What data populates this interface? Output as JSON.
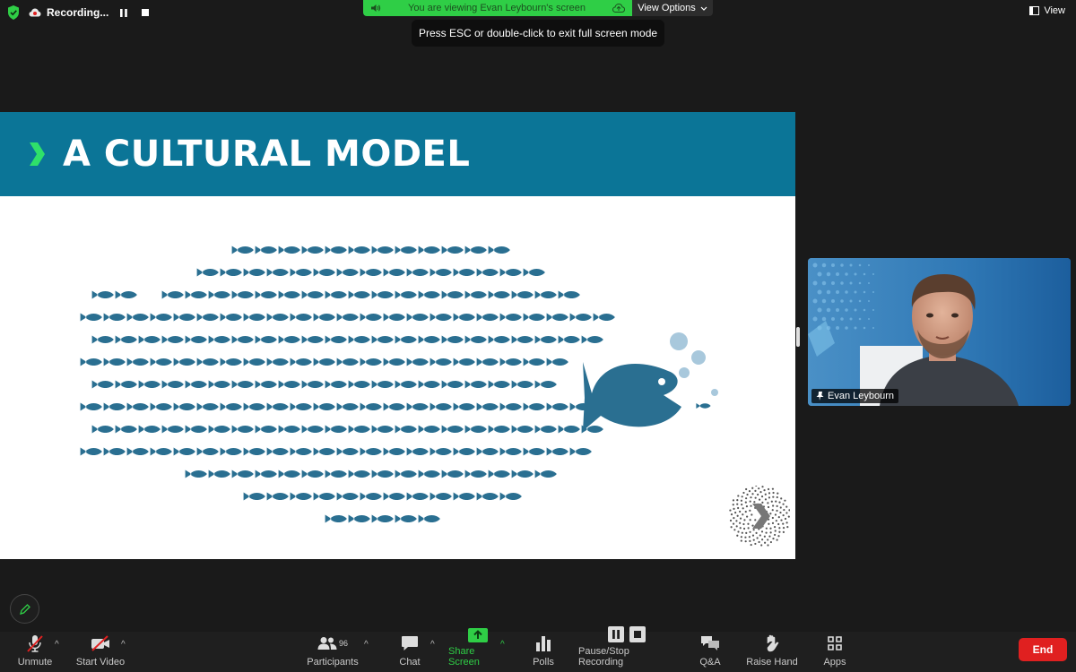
{
  "topbar": {
    "recording_label": "Recording...",
    "viewing_text": "You are viewing Evan Leybourn's screen",
    "view_options_label": "View Options",
    "esc_tip": "Press ESC or double-click to exit full screen mode",
    "view_label": "View"
  },
  "slide": {
    "title": "A CULTURAL MODEL"
  },
  "video": {
    "participant_name": "Evan Leybourn"
  },
  "toolbar": {
    "unmute": "Unmute",
    "start_video": "Start Video",
    "participants": "Participants",
    "participants_count": "96",
    "chat": "Chat",
    "share_screen": "Share Screen",
    "polls": "Polls",
    "pause_stop_recording": "Pause/Stop Recording",
    "qa": "Q&A",
    "raise_hand": "Raise Hand",
    "apps": "Apps",
    "end": "End"
  },
  "colors": {
    "slide_header": "#0b7597",
    "fish": "#2a6f91",
    "accent_green": "#2fce46",
    "end_red": "#e02020"
  }
}
